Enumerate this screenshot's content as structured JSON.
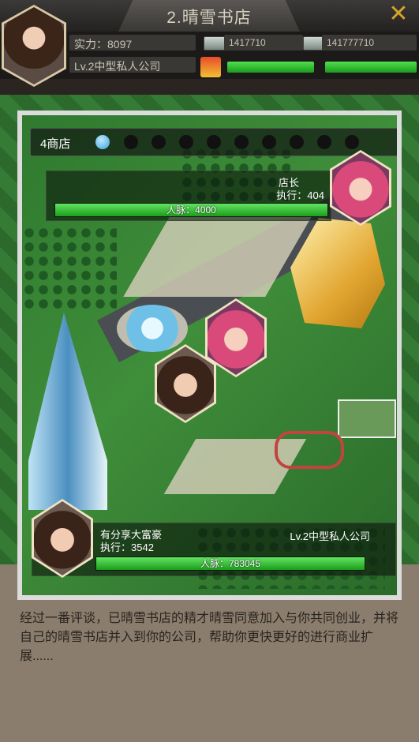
{
  "window": {
    "title": "2.晴雪书店"
  },
  "header": {
    "power_label": "实力：8097",
    "company_level": "Lv.2中型私人公司",
    "money_1": "1417710",
    "money_2": "141777710"
  },
  "panel": {
    "store_label": "4商店",
    "pager": {
      "total": 10,
      "active": 1
    },
    "manager": {
      "title": "店长",
      "execution": "执行：404",
      "network": "人脉：4000",
      "network_fill": 1.0
    },
    "player": {
      "name": "有分享大富豪",
      "execution": "执行：3542",
      "company": "Lv.2中型私人公司",
      "network": "人脉：783045",
      "network_fill": 1.0
    }
  },
  "story": {
    "text": "经过一番评谈，已晴雪书店的精才晴雪同意加入与你共同创业，并将自己的晴雪书店并入到你的公司，帮助你更快更好的进行商业扩展......"
  },
  "colors": {
    "accent_gold": "#d4a32a",
    "bar_green": "#3cc43c"
  }
}
